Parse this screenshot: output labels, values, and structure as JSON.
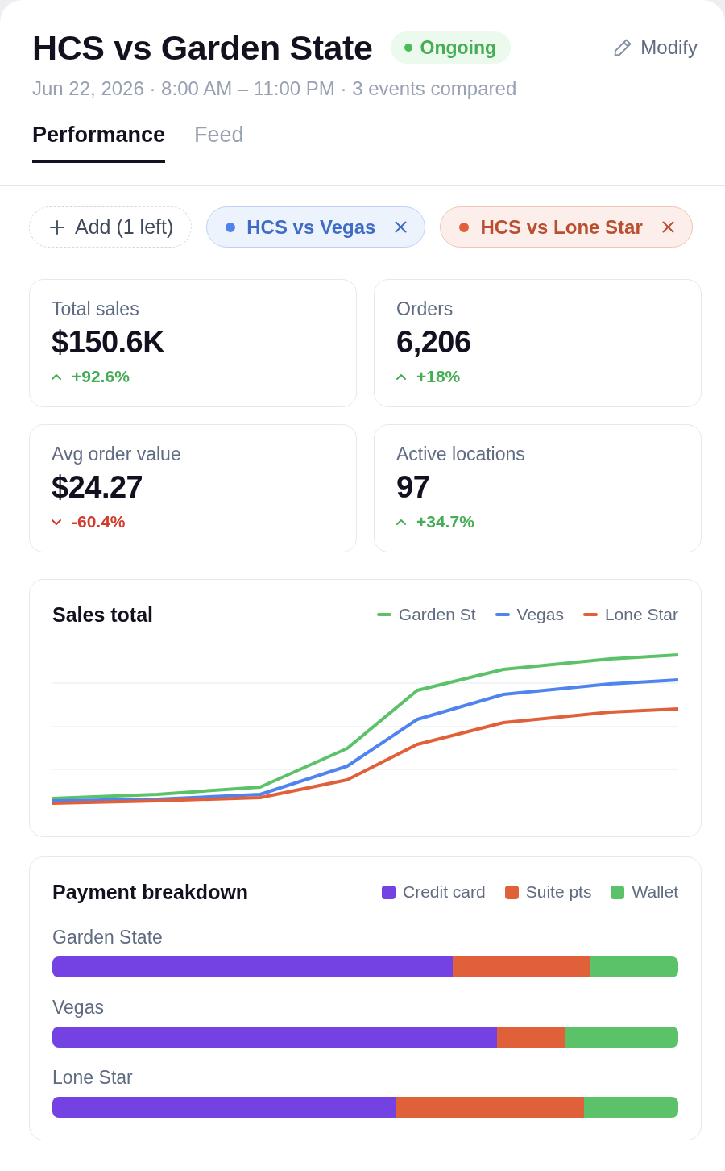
{
  "header": {
    "title": "HCS vs Garden State",
    "status": "Ongoing",
    "action": "Modify",
    "subtitle": "Jun 22, 2026 · 8:00 AM – 11:00 PM · 3 events compared"
  },
  "tabs": [
    {
      "label": "Performance",
      "selected": true
    },
    {
      "label": "Feed",
      "selected": false
    }
  ],
  "chips": [
    {
      "kind": "add",
      "label": "Add (1 left)"
    },
    {
      "kind": "event",
      "label": "HCS vs Vegas",
      "color": "#4f84ef"
    },
    {
      "kind": "event",
      "label": "HCS vs Lone Star",
      "color": "#e0603a"
    }
  ],
  "stats": [
    {
      "label": "Total sales",
      "value": "$150.6K",
      "change": "+92.6%",
      "rising": true
    },
    {
      "label": "Orders",
      "value": "6,206",
      "change": "+18%",
      "rising": true
    },
    {
      "label": "Avg order value",
      "value": "$24.27",
      "change": "-60.4%",
      "rising": false
    },
    {
      "label": "Active locations",
      "value": "97",
      "change": "+34.7%",
      "rising": true
    }
  ],
  "sales_chart": {
    "title": "Sales total",
    "legend": [
      {
        "label": "Garden St",
        "color": "#5cc269"
      },
      {
        "label": "Vegas",
        "color": "#4f84ef"
      },
      {
        "label": "Lone Star",
        "color": "#e0603a"
      }
    ]
  },
  "payment": {
    "title": "Payment breakdown",
    "legend": [
      {
        "label": "Credit card",
        "color": "#7441e3"
      },
      {
        "label": "Suite pts",
        "color": "#e0603a"
      },
      {
        "label": "Wallet",
        "color": "#5cc269"
      }
    ],
    "rows": [
      {
        "label": "Garden State"
      },
      {
        "label": "Vegas"
      },
      {
        "label": "Lone Star"
      }
    ]
  }
}
